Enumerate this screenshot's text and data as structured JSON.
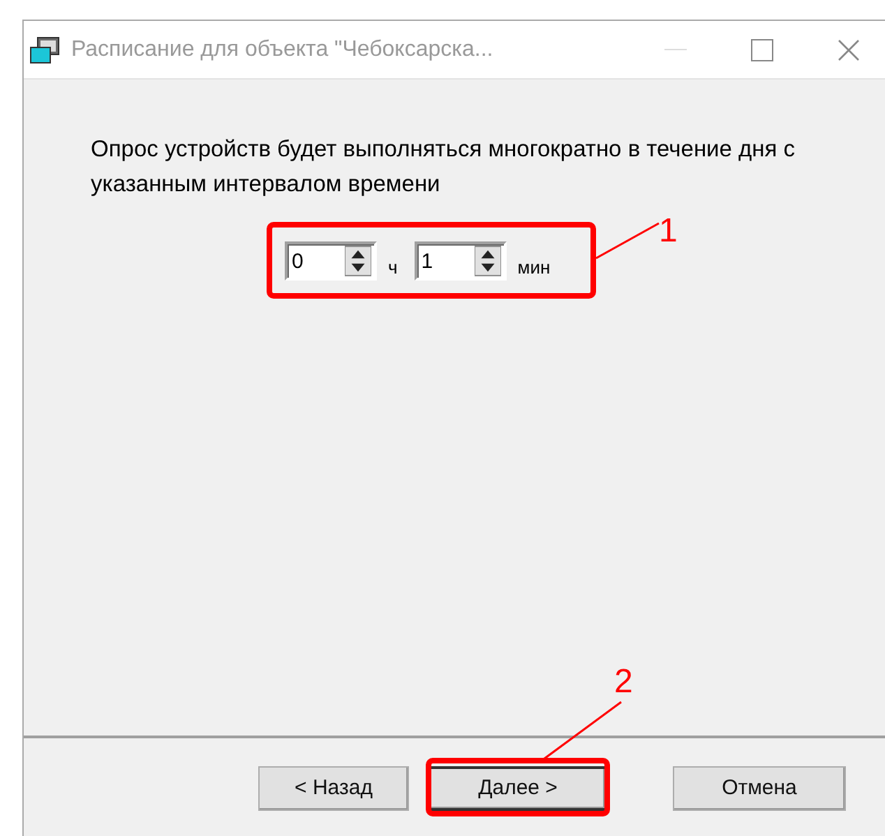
{
  "window": {
    "title": "Расписание для объекта \"Чебоксарска..."
  },
  "description": "Опрос устройств будет выполняться многократно в течение дня с указанным интервалом времени",
  "spinners": [
    {
      "value": "0",
      "unit": "ч"
    },
    {
      "value": "1",
      "unit": "мин"
    }
  ],
  "buttons": [
    {
      "label": "< Назад",
      "default": false
    },
    {
      "label": "Далее >",
      "default": true
    },
    {
      "label": "Отмена",
      "default": false
    }
  ],
  "callouts": [
    {
      "label": "1"
    },
    {
      "label": "2"
    }
  ]
}
